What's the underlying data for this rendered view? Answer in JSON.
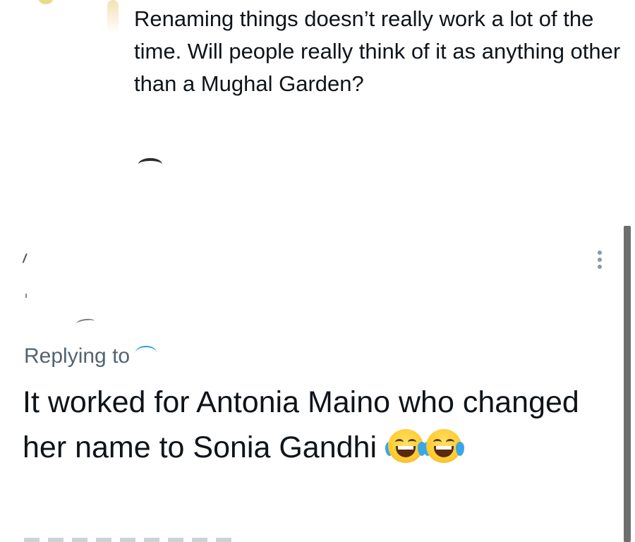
{
  "parent_tweet": {
    "text": "Renaming things doesn’t really work a lot of the time. Will people really think of it as anything other than a Mughal Garden?"
  },
  "reply_tweet": {
    "replying_to_label": "Replying to",
    "text": "It worked for Antonia Maino who changed her name to Sonia Gandhi",
    "emoji": [
      "face-with-tears-of-joy",
      "face-with-tears-of-joy"
    ]
  },
  "icons": {
    "more": "more-options-icon"
  },
  "colors": {
    "text_primary": "#0f1419",
    "text_secondary": "#536471",
    "link": "#1d9bf0",
    "icon_gray": "#8b98a5",
    "scrollbar": "#6e6e6e"
  }
}
